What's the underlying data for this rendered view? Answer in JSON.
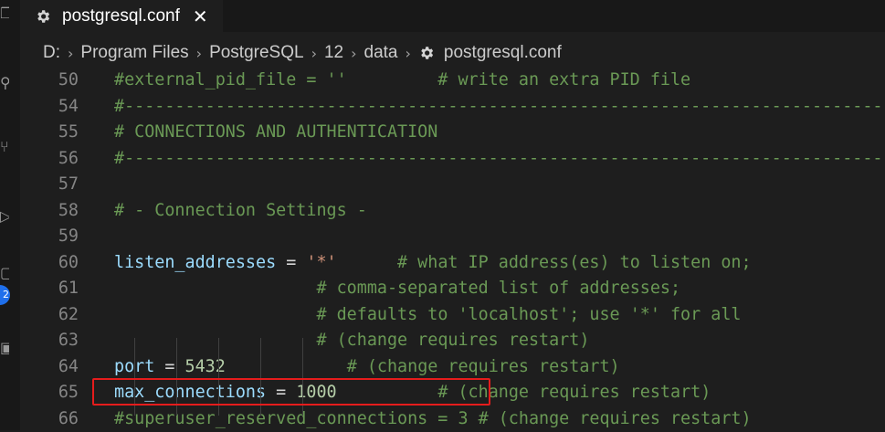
{
  "tab": {
    "label": "postgresql.conf",
    "close": "✕",
    "icon": "gear-icon"
  },
  "breadcrumb": {
    "items": [
      "D:",
      "Program Files",
      "PostgreSQL",
      "12",
      "data",
      "postgresql.conf"
    ],
    "separator": "›"
  },
  "activity_badge": "2",
  "lines": [
    {
      "num": "50",
      "tokens": [
        {
          "cls": "c",
          "text": "#external_pid_file = ''         # write an extra PID file"
        }
      ]
    },
    {
      "num": "54",
      "tokens": [
        {
          "cls": "c",
          "text": "#------------------------------------------------------------------------------"
        }
      ]
    },
    {
      "num": "55",
      "tokens": [
        {
          "cls": "c",
          "text": "# CONNECTIONS AND AUTHENTICATION"
        }
      ]
    },
    {
      "num": "56",
      "tokens": [
        {
          "cls": "c",
          "text": "#------------------------------------------------------------------------------"
        }
      ]
    },
    {
      "num": "57",
      "tokens": []
    },
    {
      "num": "58",
      "tokens": [
        {
          "cls": "c",
          "text": "# - Connection Settings -"
        }
      ]
    },
    {
      "num": "59",
      "tokens": []
    },
    {
      "num": "60",
      "tokens": [
        {
          "cls": "k",
          "text": "listen_addresses"
        },
        {
          "cls": "o",
          "text": " = "
        },
        {
          "cls": "s",
          "text": "'*'"
        },
        {
          "cls": "o",
          "text": "      "
        },
        {
          "cls": "c",
          "text": "# what IP address(es) to listen on;"
        }
      ]
    },
    {
      "num": "61",
      "tokens": [
        {
          "cls": "o",
          "text": "                    "
        },
        {
          "cls": "c",
          "text": "# comma-separated list of addresses;"
        }
      ]
    },
    {
      "num": "62",
      "tokens": [
        {
          "cls": "o",
          "text": "                    "
        },
        {
          "cls": "c",
          "text": "# defaults to 'localhost'; use '*' for all"
        }
      ]
    },
    {
      "num": "63",
      "tokens": [
        {
          "cls": "o",
          "text": "                    "
        },
        {
          "cls": "c",
          "text": "# (change requires restart)"
        }
      ]
    },
    {
      "num": "64",
      "tokens": [
        {
          "cls": "k",
          "text": "port"
        },
        {
          "cls": "o",
          "text": " = "
        },
        {
          "cls": "n",
          "text": "5432"
        },
        {
          "cls": "o",
          "text": "            "
        },
        {
          "cls": "c",
          "text": "# (change requires restart)"
        }
      ]
    },
    {
      "num": "65",
      "tokens": [
        {
          "cls": "k",
          "text": "max_connections"
        },
        {
          "cls": "o",
          "text": " = "
        },
        {
          "cls": "n",
          "text": "1000"
        },
        {
          "cls": "o",
          "text": "          "
        },
        {
          "cls": "c",
          "text": "# (change requires restart)"
        }
      ]
    },
    {
      "num": "66",
      "tokens": [
        {
          "cls": "c",
          "text": "#superuser_reserved_connections = 3 # (change requires restart)"
        }
      ]
    }
  ],
  "colors": {
    "comment": "#6a9955",
    "key": "#9cdcfe",
    "string": "#ce9178",
    "number": "#b5cea8",
    "highlight": "#e51c1c",
    "background": "#1e1e1e"
  }
}
